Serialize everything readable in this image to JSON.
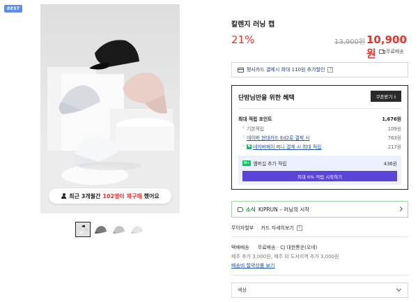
{
  "badge": "BEST",
  "gallery": {
    "repurchase_prefix": "최근 3개월간",
    "repurchase_highlight": "102명이 재구매",
    "repurchase_suffix": "했어요",
    "thumbnail_count": 4
  },
  "product": {
    "title": "칼렌지 러닝 캡",
    "discount_rate": "21%",
    "original_price": "13,900원",
    "sale_price": "10,900원",
    "shipping_badge": "무료배송"
  },
  "card_promo": {
    "text": "평사카드 결제시 최대 110원 추가할인",
    "help": "?"
  },
  "benefits": {
    "heading": "단밤님만을 위한 혜택",
    "coupon_button": "쿠폰받기",
    "max_points_label": "최대 적립 포인트",
    "max_points_value": "1,676원",
    "rows": [
      {
        "label": "기본적립",
        "value": "109원"
      },
      {
        "label": "네이버 현대카드 Ed2로 결제 시",
        "value": "763원"
      },
      {
        "label": "네이버페이 머니 결제 시 최대 적립",
        "value": "217원"
      }
    ],
    "membership_label": "멤버십 추가 적립",
    "membership_badge": "N+",
    "membership_value": "436원",
    "membership_button": "최대 6% 적립 시작하기"
  },
  "promo": {
    "brand_label": "소식",
    "text": "KIPRUN – 러닝의 시작"
  },
  "payment": {
    "installment": "무이자할부",
    "card_info": "카드 자세히보기",
    "help": "?"
  },
  "delivery": {
    "label": "택배배송",
    "detail": "무료배송 · CJ 대한통운(오네)",
    "extra": "제주 추가 3,000원, 제주 외 도서지역 추가 3,000원",
    "link": "배송비 절약상품 보기"
  },
  "option": {
    "placeholder": "색상"
  },
  "colors": {
    "accent_red": "#e5342b",
    "purple": "#5a45d8",
    "naver_green": "#03c75a"
  }
}
